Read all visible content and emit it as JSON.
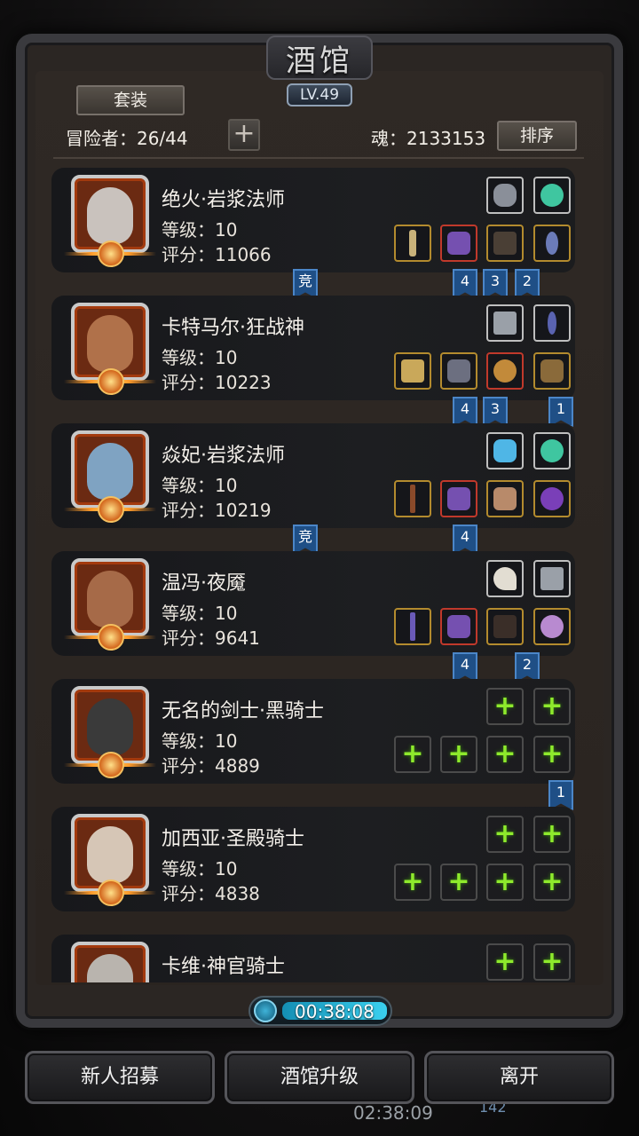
{
  "header": {
    "title": "酒馆",
    "level": "LV.49",
    "set_button": "套装",
    "adventurer_label": "冒险者：26/44",
    "add_icon": "plus-icon",
    "soul_label": "魂：2133153",
    "sort_button": "排序"
  },
  "heroes": [
    {
      "name": "绝火·岩浆法师",
      "level": "等级：10",
      "score": "评分：11066",
      "face_color": "#c9c2bd",
      "ribbons": [
        "竞",
        "4",
        "3",
        "2"
      ]
    },
    {
      "name": "卡特马尔·狂战神",
      "level": "等级：10",
      "score": "评分：10223",
      "face_color": "#b0714a",
      "ribbons": [
        "4",
        "3",
        "1"
      ]
    },
    {
      "name": "焱妃·岩浆法师",
      "level": "等级：10",
      "score": "评分：10219",
      "face_color": "#7fa3c2",
      "ribbons": [
        "竞",
        "4"
      ]
    },
    {
      "name": "温冯·夜魇",
      "level": "等级：10",
      "score": "评分：9641",
      "face_color": "#a66a48",
      "ribbons": [
        "4",
        "2"
      ]
    },
    {
      "name": "无名的剑士·黑骑士",
      "level": "等级：10",
      "score": "评分：4889",
      "face_color": "#3a3a3a",
      "ribbons": [
        "1"
      ]
    },
    {
      "name": "加西亚·圣殿骑士",
      "level": "等级：10",
      "score": "评分：4838",
      "face_color": "#d6c6b6",
      "ribbons": []
    },
    {
      "name": "卡维·神官骑士",
      "level": "",
      "score": "",
      "face_color": "#b9b4ae",
      "ribbons": []
    }
  ],
  "timer": {
    "value": "00:38:08",
    "icon": "clock-icon"
  },
  "bottom": {
    "recruit": "新人招募",
    "upgrade": "酒馆升级",
    "leave": "离开",
    "under_timer": "02:38:09",
    "under_count": "142"
  }
}
